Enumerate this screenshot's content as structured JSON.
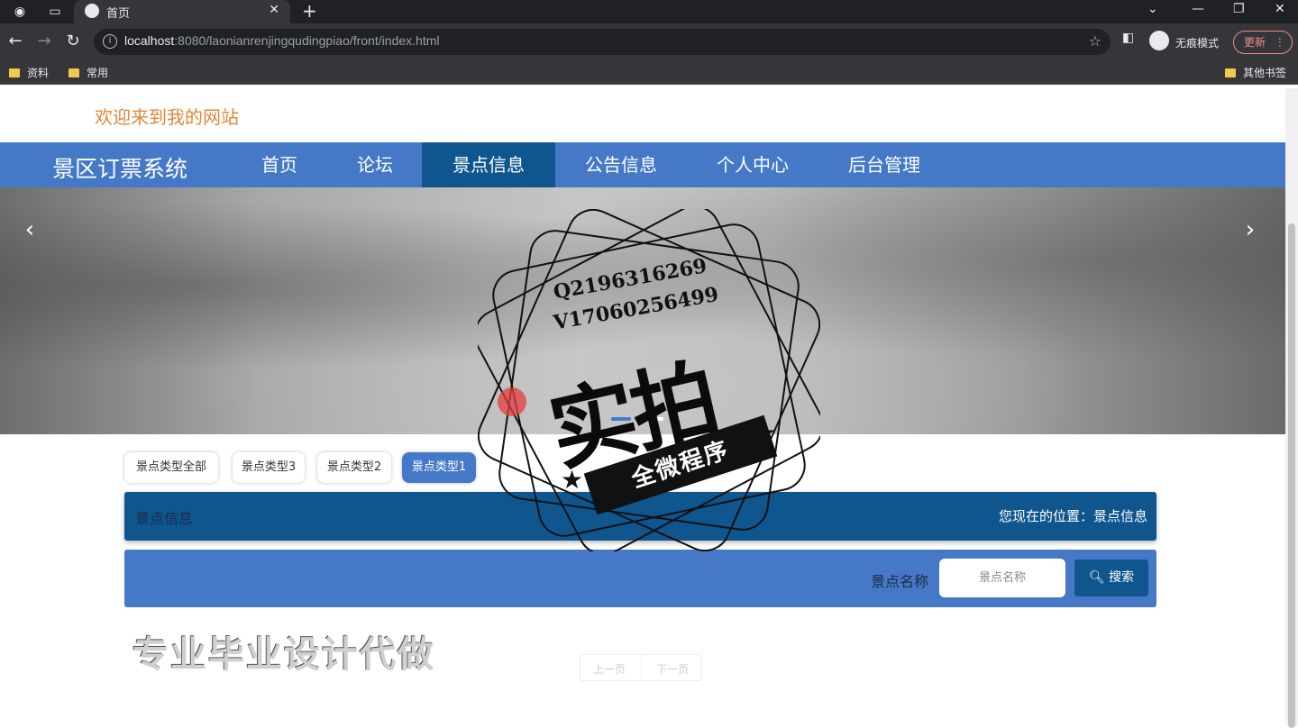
{
  "browser": {
    "tab_title": "首页",
    "url_host": "localhost",
    "url_rest": ":8080/laonianrenjingqudingpiao/front/index.html",
    "incognito_label": "无痕模式",
    "update_label": "更新",
    "bookmarks": [
      "资料",
      "常用"
    ],
    "other_bookmarks": "其他书签"
  },
  "header": {
    "welcome": "欢迎来到我的网站",
    "brand": "景区订票系统",
    "nav": [
      "首页",
      "论坛",
      "景点信息",
      "公告信息",
      "个人中心",
      "后台管理"
    ],
    "active_nav": "景点信息"
  },
  "filters": [
    "景点类型全部",
    "景点类型3",
    "景点类型2",
    "景点类型1"
  ],
  "active_filter": "景点类型1",
  "breadcrumb": {
    "title": "景点信息",
    "position": "您现在的位置：景点信息"
  },
  "search": {
    "label": "景点名称",
    "placeholder": "景点名称",
    "button": "搜索"
  },
  "pager": {
    "prev": "上一页",
    "next": "下一页"
  },
  "overlay": {
    "contact_q": "Q2196316269",
    "contact_v": "V17060256499",
    "stamp_big": "实拍",
    "stamp_ribbon": "全微程序",
    "bottom_text": "专业毕业设计代做"
  },
  "colors": {
    "nav_bg": "#4579c8",
    "nav_active": "#0f568f",
    "welcome": "#e0873a"
  }
}
